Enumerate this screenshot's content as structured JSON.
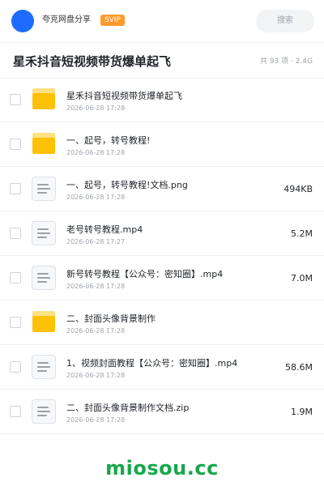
{
  "header": {
    "app_name": "夸克网盘分享",
    "badge": "SVIP",
    "search_placeholder": "搜索"
  },
  "share": {
    "title": "星禾抖音短视频带货爆单起飞",
    "summary": "共 93 项 · 2.4G"
  },
  "files": [
    {
      "type": "folder",
      "name": "星禾抖音短视频带货爆单起飞",
      "date": "2026-06-28 17:28",
      "size": ""
    },
    {
      "type": "folder",
      "name": "一、起号，转号教程!",
      "date": "2026-06-28 17:28",
      "size": ""
    },
    {
      "type": "file",
      "name": "一、起号，转号教程!文档.png",
      "date": "2026-06-28 17:28",
      "size": "494KB"
    },
    {
      "type": "file",
      "name": "老号转号教程.mp4",
      "date": "2026-06-28 17:27",
      "size": "5.2M"
    },
    {
      "type": "file",
      "name": "新号转号教程【公众号：密知圈】.mp4",
      "date": "2026-06-28 17:28",
      "size": "7.0M"
    },
    {
      "type": "folder",
      "name": "二、封面头像背景制作",
      "date": "2026-06-28 17:28",
      "size": ""
    },
    {
      "type": "file",
      "name": "1、视频封面教程【公众号：密知圈】.mp4",
      "date": "2026-06-28 17:28",
      "size": "58.6M"
    },
    {
      "type": "file",
      "name": "二、封面头像背景制作文档.zip",
      "date": "2026-06-28 17:28",
      "size": "1.9M"
    }
  ],
  "watermark": "miosou.cc"
}
